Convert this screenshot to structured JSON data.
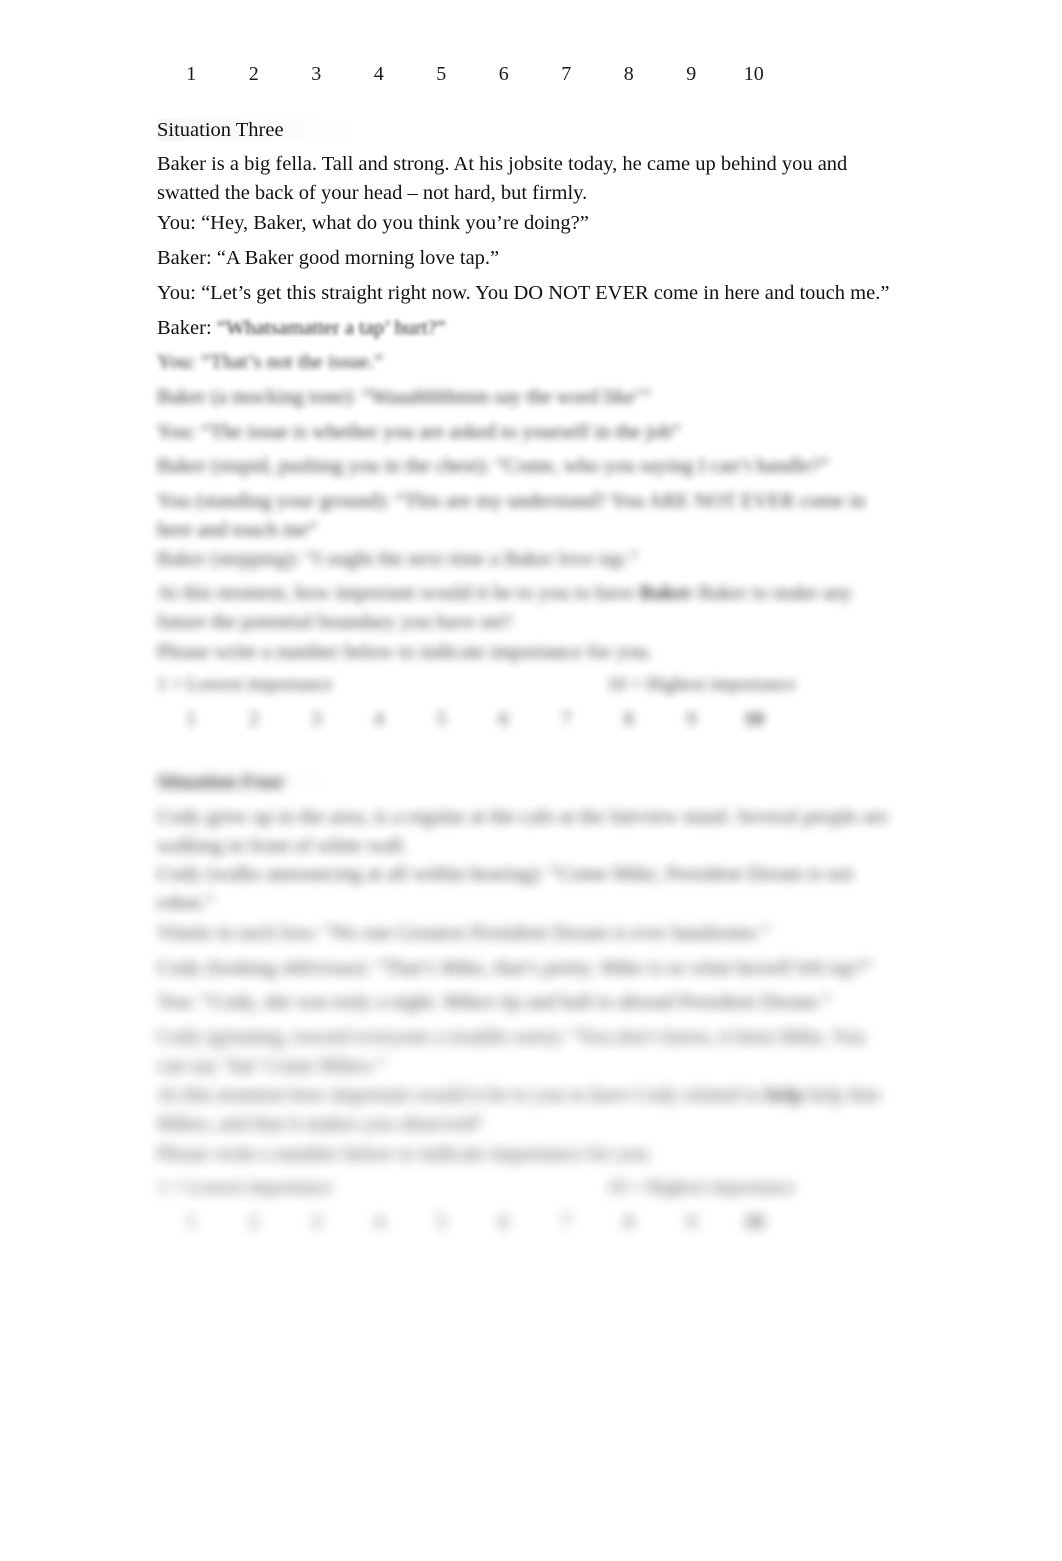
{
  "document": {
    "page_background": "#ffffff",
    "text_color": "#111111"
  },
  "top_scale": {
    "name": "rating-scale-top",
    "numbers": [
      "1",
      "2",
      "3",
      "4",
      "5",
      "6",
      "7",
      "8",
      "9",
      "10"
    ]
  },
  "situation_three": {
    "heading": "Situation Three",
    "paragraphs": [
      "Baker is a big fella. Tall and strong. At his jobsite today, he came up behind you and swatted the back of your head – not hard, but firmly.",
      "You:  “Hey, Baker, what do you think you’re doing?”",
      "Baker: “A Baker good morning love tap.”",
      "You:  “Let’s get this straight right now. You DO NOT EVER come in here and touch me.”"
    ],
    "redacted_lines": [
      {
        "prefix": "Baker:",
        "body": "“Whatsamatter a tap’ hurt?”",
        "blur": "b1"
      },
      {
        "prefix": "You:",
        "body": "“That’s not the issue.”",
        "blur": "b2"
      },
      {
        "prefix": "Baker (a mocking tone):",
        "body": "“Waaahhhhmm say the word like’”",
        "blur": "b3"
      },
      {
        "prefix": "You:",
        "body": "“The issue is whether you are asked to yourself in the job”",
        "blur": "b3"
      },
      {
        "prefix": "Baker (stupid, pushing you in the chest):",
        "body": "“Come, who you saying I can’t handle?”",
        "blur": "b4"
      },
      {
        "prefix": "You (standing your ground):",
        "body": "“This are my understand? You ARE NOT EVER come in here and touch me”",
        "blur": "b4"
      },
      {
        "prefix": "Baker (stepping):",
        "body": "“I ought the next time a Baker love tap.”",
        "blur": "b5"
      },
      {
        "prefix": "At this moment, how important would it be to you to have",
        "body": "Baker to make any future the potential boundary you have set?",
        "blur": "b5",
        "bold_segment": "Baker"
      },
      {
        "prefix": "Please write a number below to indicate importance for you.",
        "body": "",
        "blur": "b5"
      }
    ],
    "rating_block": {
      "left_anchor": "1 = Lowest importance",
      "right_anchor": "10 = Highest importance",
      "numbers": [
        "1",
        "2",
        "3",
        "4",
        "5",
        "6",
        "7",
        "8",
        "9",
        "10"
      ]
    }
  },
  "situation_four": {
    "heading": "Situation Four",
    "redacted_lines": [
      {
        "prefix": "Cody grew up in the area, is a regular at the cafe at the fairview stand. Several people are walking in front of white wall.",
        "body": "",
        "blur": "b6"
      },
      {
        "prefix": "Cody (walks announcing at all within hearing):",
        "body": "“Come Mike, President Dream is not robot.”",
        "blur": "b6"
      },
      {
        "prefix": "Vinnie in such loss:",
        "body": "“No one Greatest President Dream is ever handsome.”",
        "blur": "b7"
      },
      {
        "prefix": "Cody (looking oblivious):",
        "body": "“That’s Mike, that’s pretty. Mike is so what herself left tap?”",
        "blur": "b7"
      },
      {
        "prefix": "You:",
        "body": "“Cody, she was truly a night. Mikes tip and hall to abroad President Dream.”",
        "blur": "b7"
      },
      {
        "prefix": "Cody (grinning, toward everyone a trouble sorts):",
        "body": "“You don’t know, it been Mike, You can say ‘hat’ Come Mikes.”",
        "blur": "b8"
      },
      {
        "prefix": "At this moment how important would it be to you to have Cody related to",
        "body": "help that Mikes, and that it makes you observed?",
        "blur": "b8",
        "bold_segment": "help"
      },
      {
        "prefix": "Please write a number below to indicate importance for you.",
        "body": "",
        "blur": "b8"
      }
    ],
    "rating_block": {
      "left_anchor": "1 = Lowest importance",
      "right_anchor": "10 = Highest importance",
      "numbers": [
        "1",
        "2",
        "3",
        "4",
        "5",
        "6",
        "7",
        "8",
        "9",
        "10"
      ]
    }
  }
}
